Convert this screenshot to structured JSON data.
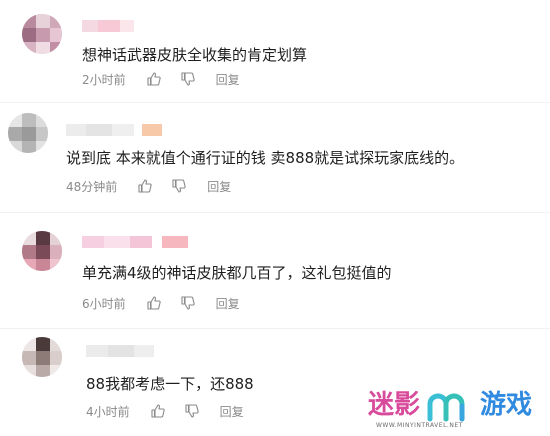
{
  "comments": [
    {
      "text": "想神话武器皮肤全收集的肯定划算",
      "time": "2小时前",
      "reply_label": "回复"
    },
    {
      "text": "说到底 本来就值个通行证的钱 卖888就是试探玩家底线的。",
      "time": "48分钟前",
      "reply_label": "回复"
    },
    {
      "text": "单充满4级的神话皮肤都几百了，这礼包挺值的",
      "time": "6小时前",
      "reply_label": "回复"
    },
    {
      "text": "88我都考虑一下，还888",
      "time": "4小时前",
      "reply_label": "回复"
    }
  ],
  "icons": {
    "like": "thumbs-up-icon",
    "dislike": "thumbs-down-icon"
  },
  "watermark": {
    "part1": "迷影",
    "part3": "游戏",
    "subtitle": "WWW.MINYINTRAVEL.NET",
    "colors": {
      "mi": "#e8447a",
      "ying": "#c14fc9",
      "logo": "#3bbfd6",
      "you": "#3aa6e0",
      "xi": "#2f8ae0"
    }
  }
}
